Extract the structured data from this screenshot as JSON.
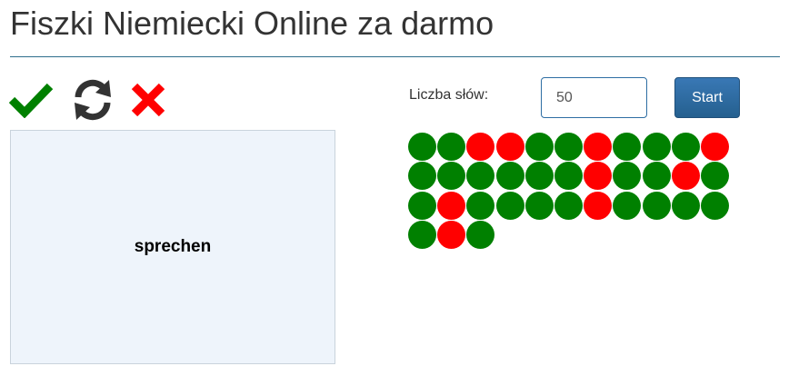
{
  "page": {
    "title": "Fiszki Niemiecki Online za darmo"
  },
  "toolbar": {
    "correct_icon": "checkmark-icon",
    "flip_icon": "refresh-icon",
    "wrong_icon": "close-icon",
    "colors": {
      "correct": "#008000",
      "flip": "#333333",
      "wrong": "#ff0000"
    }
  },
  "card": {
    "word": "sprechen"
  },
  "controls": {
    "count_label": "Liczba słów:",
    "count_value": "50",
    "start_label": "Start"
  },
  "results": {
    "colors": {
      "correct": "#008000",
      "wrong": "#ff0000"
    },
    "rows": [
      [
        "correct",
        "correct",
        "wrong",
        "wrong",
        "correct",
        "correct",
        "wrong",
        "correct",
        "correct",
        "correct",
        "wrong",
        "correct"
      ],
      [
        "correct",
        "correct",
        "correct",
        "correct",
        "correct",
        "wrong",
        "correct",
        "correct",
        "wrong",
        "correct",
        "correct",
        "wrong"
      ],
      [
        "correct",
        "correct",
        "correct",
        "correct",
        "wrong",
        "correct",
        "correct",
        "correct",
        "correct",
        "correct",
        "wrong",
        "correct"
      ]
    ]
  }
}
